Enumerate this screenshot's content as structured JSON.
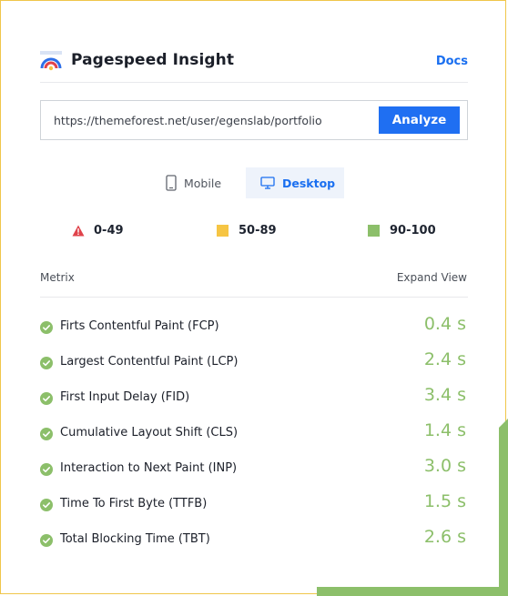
{
  "header": {
    "title": "Pagespeed Insight",
    "docs_label": "Docs",
    "logo_icon": "speedometer-logo-icon"
  },
  "search": {
    "url_value": "https://themeforest.net/user/egenslab/portfolio",
    "button_label": "Analyze"
  },
  "device_tabs": {
    "mobile_label": "Mobile",
    "desktop_label": "Desktop",
    "selected": "Desktop"
  },
  "legend": [
    {
      "label": "0-49",
      "icon": "warning-triangle-icon",
      "color": "#e0434b"
    },
    {
      "label": "50-89",
      "icon": "square-icon",
      "color": "#f6c544"
    },
    {
      "label": "90-100",
      "icon": "square-icon",
      "color": "#8cbf6a"
    }
  ],
  "table": {
    "col_metric": "Metrix",
    "col_expand": "Expand View",
    "rows": [
      {
        "label": "Firts Contentful Paint (FCP)",
        "value": "0.4 s"
      },
      {
        "label": "Largest Contentful Paint (LCP)",
        "value": "2.4 s"
      },
      {
        "label": "First Input Delay (FID)",
        "value": "3.4 s"
      },
      {
        "label": "Cumulative Layout Shift (CLS)",
        "value": "1.4 s"
      },
      {
        "label": "Interaction to Next Paint (INP)",
        "value": "3.0 s"
      },
      {
        "label": "Time To First Byte (TTFB)",
        "value": "1.5 s"
      },
      {
        "label": "Total Blocking Time (TBT)",
        "value": "2.6 s"
      }
    ]
  },
  "colors": {
    "accent": "#1f6ff2",
    "good": "#8cbf6a",
    "frame": "#f0c64a",
    "decoration": "#8cbf6a"
  }
}
